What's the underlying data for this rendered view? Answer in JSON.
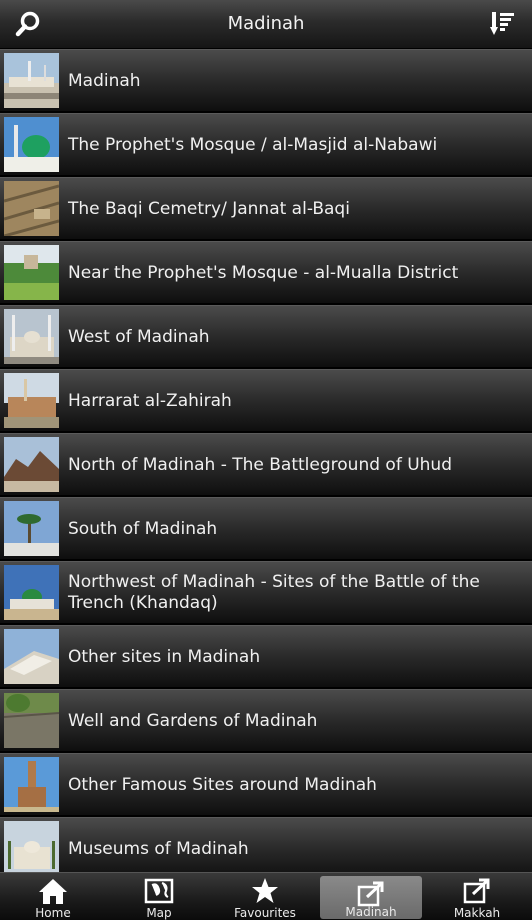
{
  "header": {
    "title": "Madinah",
    "search_icon": "search-icon",
    "sort_icon": "sort-list-icon"
  },
  "items": [
    {
      "label": "Madinah"
    },
    {
      "label": "The Prophet's Mosque / al-Masjid al-Nabawi"
    },
    {
      "label": "The Baqi Cemetry/ Jannat al-Baqi"
    },
    {
      "label": "Near the Prophet's Mosque - al-Mualla District"
    },
    {
      "label": "West of Madinah"
    },
    {
      "label": "Harrarat al-Zahirah"
    },
    {
      "label": "North of Madinah - The Battleground of Uhud"
    },
    {
      "label": "South of Madinah"
    },
    {
      "label": "Northwest of Madinah - Sites of the Battle of the Trench (Khandaq)"
    },
    {
      "label": "Other sites in Madinah"
    },
    {
      "label": "Well and Gardens of Madinah"
    },
    {
      "label": "Other Famous Sites around Madinah"
    },
    {
      "label": "Museums of Madinah"
    }
  ],
  "tabs": [
    {
      "label": "Home",
      "icon": "home-icon"
    },
    {
      "label": "Map",
      "icon": "map-icon"
    },
    {
      "label": "Favourites",
      "icon": "star-icon"
    },
    {
      "label": "Madinah",
      "icon": "external-link-icon"
    },
    {
      "label": "Makkah",
      "icon": "external-link-icon"
    }
  ],
  "active_tab": "Madinah"
}
